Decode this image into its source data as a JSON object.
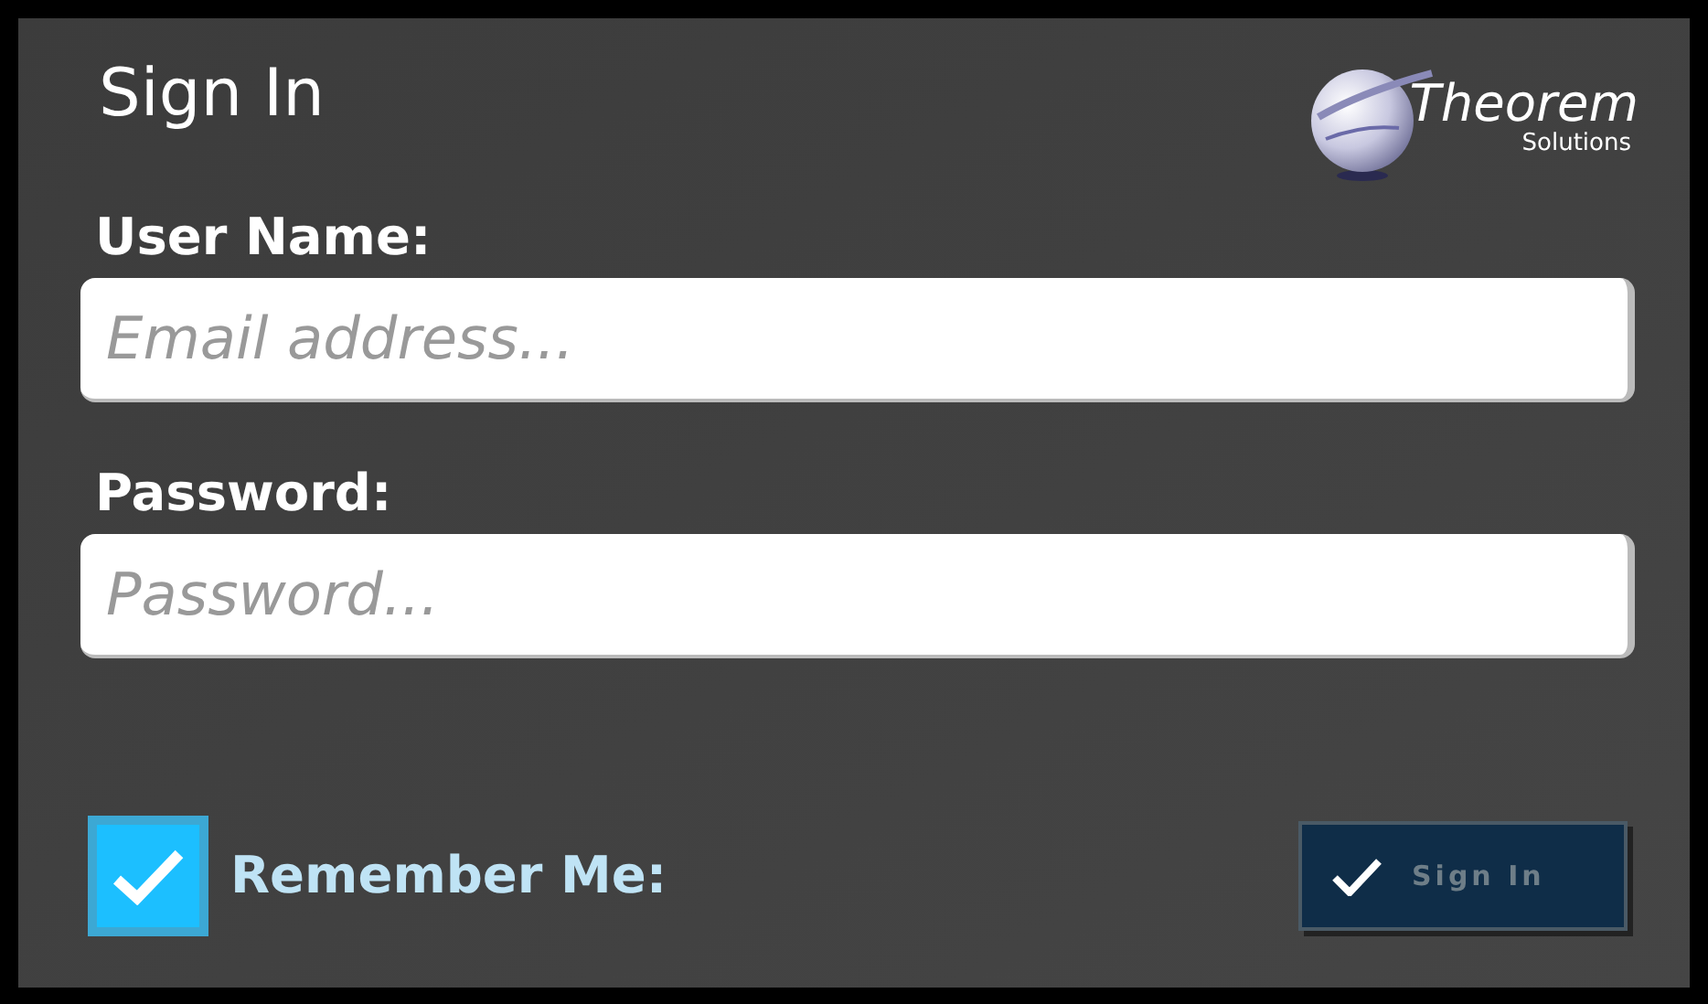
{
  "title": "Sign In",
  "logo": {
    "name": "Theorem",
    "tagline": "Solutions"
  },
  "fields": [
    {
      "label": "User Name:",
      "placeholder": "Email address..."
    },
    {
      "label": "Password:",
      "placeholder": "Password..."
    }
  ],
  "remember_me": {
    "label": "Remember Me:",
    "checked": true
  },
  "sign_in_button": {
    "label": "Sign In",
    "disabled": true
  }
}
